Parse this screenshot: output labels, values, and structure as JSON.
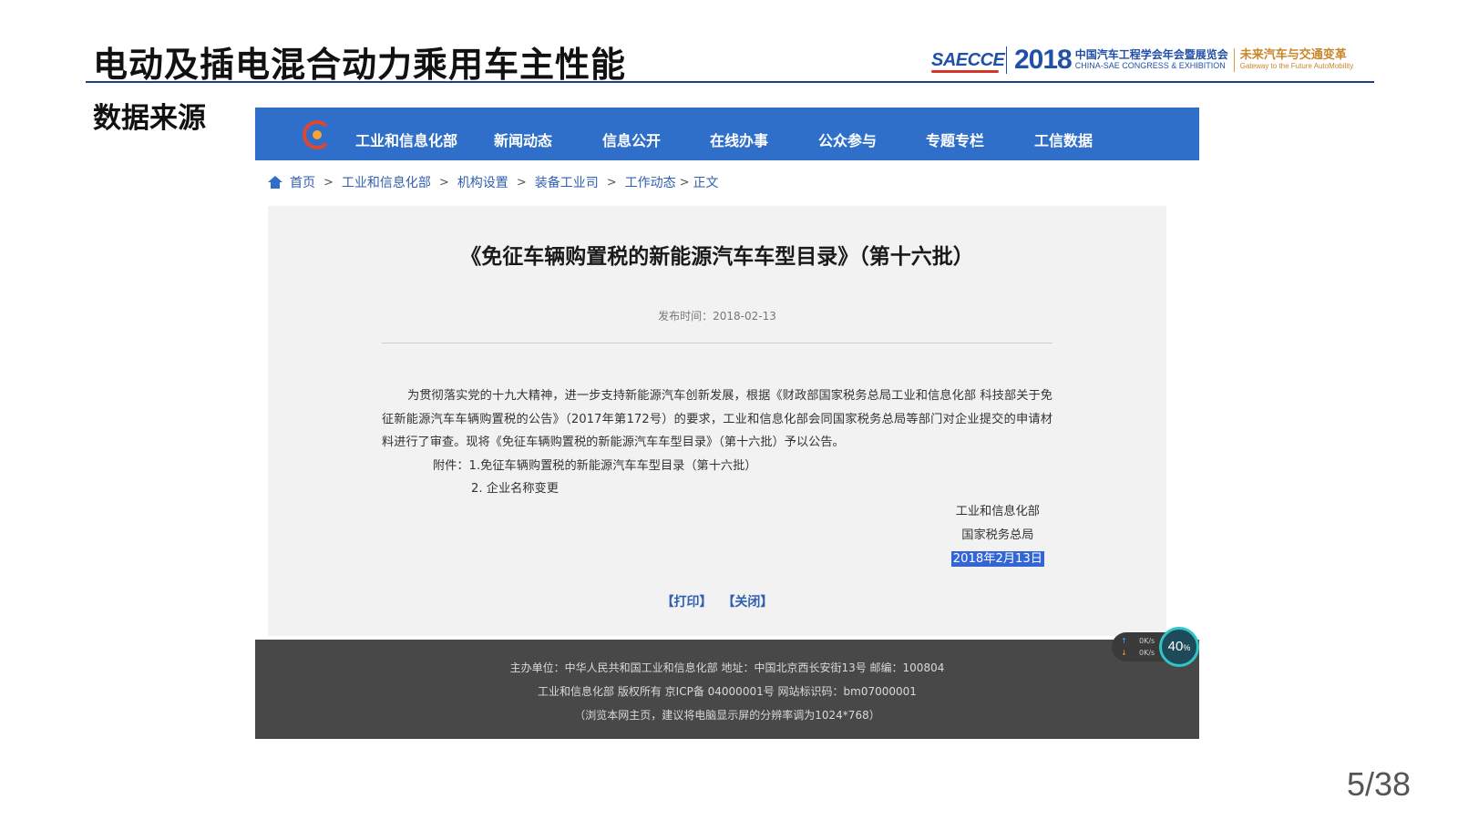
{
  "slide": {
    "title": "电动及插电混合动力乘用车主性能",
    "section": "数据来源",
    "page": "5/38"
  },
  "brand": {
    "logo": "SAECCE",
    "year": "2018",
    "name_cn": "中国汽车工程学会年会暨展览会",
    "name_en": "CHINA-SAE CONGRESS & EXHIBITION",
    "slogan_cn": "未来汽车与交通变革",
    "slogan_en": "Gateway to the Future AutoMobility"
  },
  "site": {
    "nav": [
      "工业和信息化部",
      "新闻动态",
      "信息公开",
      "在线办事",
      "公众参与",
      "专题专栏",
      "工信数据"
    ],
    "breadcrumb": [
      "首页",
      "工业和信息化部",
      "机构设置",
      "装备工业司",
      "工作动态",
      "正文"
    ],
    "breadcrumb_sep": ">"
  },
  "article": {
    "title": "《免征车辆购置税的新能源汽车车型目录》（第十六批）",
    "date": "发布时间：2018-02-13",
    "body": "为贯彻落实党的十九大精神，进一步支持新能源汽车创新发展，根据《财政部国家税务总局工业和信息化部 科技部关于免征新能源汽车车辆购置税的公告》（2017年第172号）的要求，工业和信息化部会同国家税务总局等部门对企业提交的申请材料进行了审查。现将《免征车辆购置税的新能源汽车车型目录》（第十六批）予以公告。",
    "attachment_1": "附件：1.免征车辆购置税的新能源汽车车型目录（第十六批）",
    "attachment_2": "2. 企业名称变更",
    "signer_1": "工业和信息化部",
    "signer_2": "国家税务总局",
    "sign_date": "2018年2月13日",
    "print_label": "【打印】",
    "close_label": "【关闭】"
  },
  "footer": {
    "line1": "主办单位：中华人民共和国工业和信息化部 地址：中国北京西长安街13号 邮编：100804",
    "line2": "工业和信息化部 版权所有 京ICP备 04000001号   网站标识码：bm07000001",
    "line3": "（浏览本网主页，建议将电脑显示屏的分辨率调为1024*768）"
  },
  "speed_widget": {
    "up_value": "0K/s",
    "down_value": "0K/s",
    "percent": "40",
    "percent_unit": "%"
  },
  "colors": {
    "nav_bg": "#2f6fc9",
    "title_rule": "#1f3f8f",
    "footer_bg": "#484848",
    "link": "#2f5fb0",
    "selection": "#3465d6"
  }
}
